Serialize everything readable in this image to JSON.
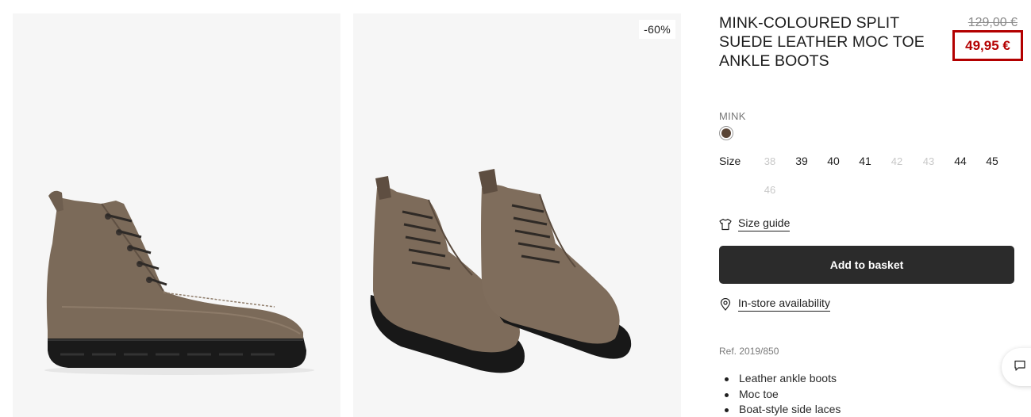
{
  "gallery": {
    "discount_badge": "-60%"
  },
  "product": {
    "title": "MINK-COLOURED SPLIT SUEDE LEATHER MOC TOE ANKLE BOOTS",
    "old_price": "129,00 €",
    "new_price": "49,95 €",
    "color_name": "MINK",
    "color_hex": "#5a4536",
    "size_label": "Size",
    "sizes": [
      {
        "label": "38",
        "available": false
      },
      {
        "label": "39",
        "available": true
      },
      {
        "label": "40",
        "available": true
      },
      {
        "label": "41",
        "available": true
      },
      {
        "label": "42",
        "available": false
      },
      {
        "label": "43",
        "available": false
      },
      {
        "label": "44",
        "available": true
      },
      {
        "label": "45",
        "available": true
      },
      {
        "label": "46",
        "available": false
      }
    ],
    "size_guide": "Size guide",
    "add_to_basket": "Add to basket",
    "in_store": "In-store availability",
    "reference": "Ref. 2019/850",
    "features": [
      "Leather ankle boots",
      "Moc toe",
      "Boat-style side laces"
    ]
  },
  "icons": {
    "size_guide": "tshirt-icon",
    "in_store": "location-pin-icon",
    "chat": "chat-bubble-icon"
  },
  "colors": {
    "price_accent": "#b40000",
    "button_bg": "#2b2b2b"
  }
}
